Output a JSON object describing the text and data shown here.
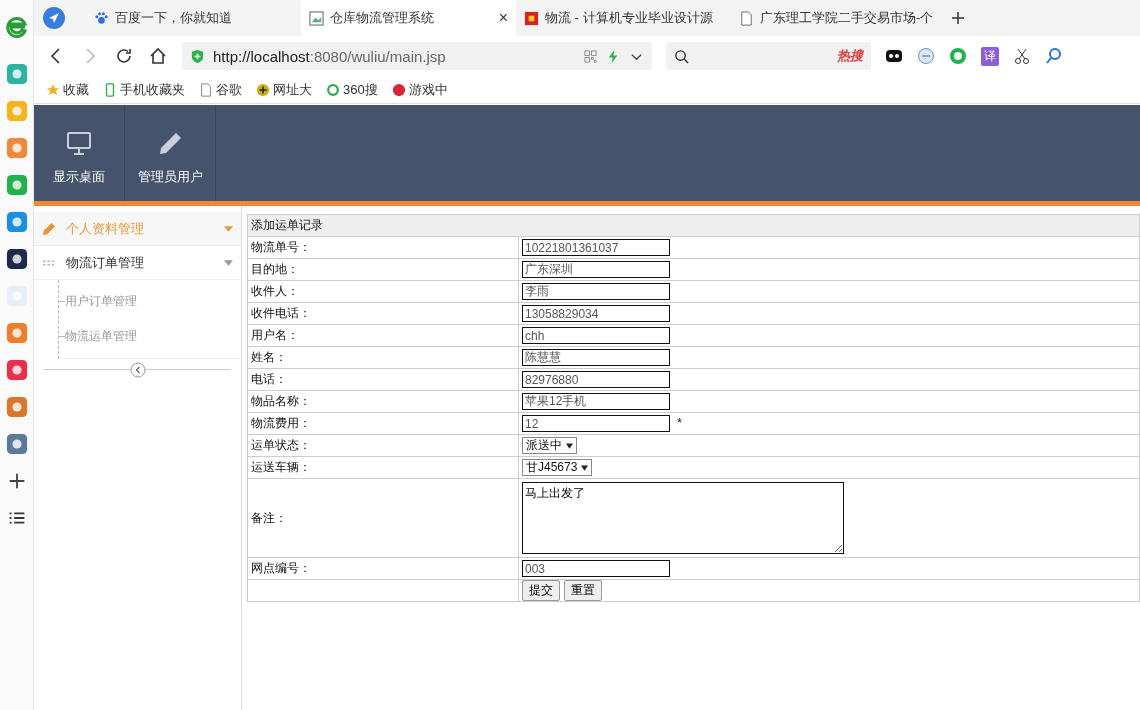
{
  "browser": {
    "tabs": [
      {
        "title": "百度一下，你就知道",
        "selected": false
      },
      {
        "title": "仓库物流管理系统",
        "selected": true
      },
      {
        "title": "物流 - 计算机专业毕业设计源",
        "selected": false
      },
      {
        "title": "广东理工学院二手交易市场-个",
        "selected": false
      }
    ],
    "close_label": "×",
    "address": {
      "url_host": "http://localhost",
      "url_rest": ":8080/wuliu/main.jsp"
    },
    "hot_search": "热搜",
    "translate": "译",
    "bookmarks": [
      {
        "label": "收藏"
      },
      {
        "label": "手机收藏夹"
      },
      {
        "label": "谷歌"
      },
      {
        "label": "网址大"
      },
      {
        "label": "360搜"
      },
      {
        "label": "游戏中"
      }
    ]
  },
  "app": {
    "nav_buttons": [
      {
        "label": "显示桌面"
      },
      {
        "label": "管理员用户"
      }
    ],
    "sidebar": {
      "items": [
        {
          "label": "个人资料管理",
          "selected": true
        },
        {
          "label": "物流订单管理",
          "selected": false,
          "children": [
            {
              "label": "用户订单管理"
            },
            {
              "label": "物流运单管理"
            }
          ]
        }
      ]
    },
    "form": {
      "title": "添加运单记录",
      "fields": [
        {
          "label": "物流单号：",
          "kind": "text",
          "value": "10221801361037"
        },
        {
          "label": "目的地：",
          "kind": "text",
          "value": "广东深圳"
        },
        {
          "label": "收件人：",
          "kind": "text",
          "value": "李雨"
        },
        {
          "label": "收件电话：",
          "kind": "text",
          "value": "13058829034"
        },
        {
          "label": "用户名：",
          "kind": "text",
          "value": "chh"
        },
        {
          "label": "姓名：",
          "kind": "text",
          "value": "陈慧慧"
        },
        {
          "label": "电话：",
          "kind": "text",
          "value": "82976880"
        },
        {
          "label": "物品名称：",
          "kind": "text",
          "value": "苹果12手机"
        },
        {
          "label": "物流费用：",
          "kind": "text",
          "value": "12",
          "suffix": "*"
        },
        {
          "label": "运单状态：",
          "kind": "select",
          "value": "派送中"
        },
        {
          "label": "运送车辆：",
          "kind": "select",
          "value": "甘J45673"
        },
        {
          "label": "备注：",
          "kind": "textarea",
          "value": "马上出发了"
        },
        {
          "label": "网点编号：",
          "kind": "text",
          "value": "003"
        }
      ],
      "buttons": [
        "提交",
        "重置"
      ]
    }
  }
}
